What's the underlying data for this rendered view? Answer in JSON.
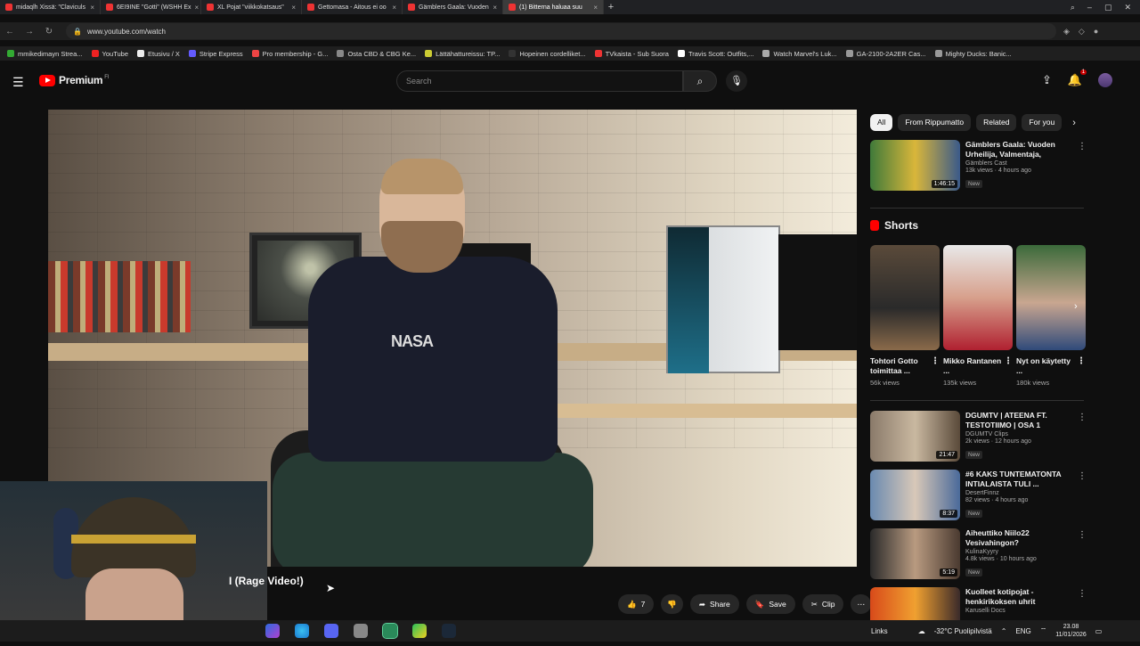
{
  "browser": {
    "tabs": [
      {
        "title": "midaqlh Xissä: \"Claviculs",
        "color": "#e33",
        "active": false
      },
      {
        "title": "6EI9INE \"Gotti\" (WSHH Ex",
        "color": "#e33",
        "active": false
      },
      {
        "title": "XL Pojat \"viikkokatsaus\"",
        "color": "#e33",
        "active": false
      },
      {
        "title": "Gettomasa - Aitous ei oo",
        "color": "#e33",
        "active": false
      },
      {
        "title": "Gämblers Gaala: Vuoden",
        "color": "#e33",
        "active": false
      },
      {
        "title": "(1) Bitterna haluaa suu",
        "color": "#e33",
        "active": true
      }
    ],
    "url": "www.youtube.com/watch",
    "bookmarks": [
      {
        "label": "mmikedimayn Strea...",
        "color": "#3a3"
      },
      {
        "label": "YouTube",
        "color": "#e22"
      },
      {
        "label": "Etusivu / X",
        "color": "#eee"
      },
      {
        "label": "Stripe Express",
        "color": "#635bff"
      },
      {
        "label": "Pro membership - G...",
        "color": "#e44"
      },
      {
        "label": "Osta CBD & CBG Ke...",
        "color": "#888"
      },
      {
        "label": "Lättähattureissu: TP...",
        "color": "#cc3"
      },
      {
        "label": "Hopeinen cordelliket...",
        "color": "#333"
      },
      {
        "label": "TVkaista - Sub Suora",
        "color": "#e33"
      },
      {
        "label": "Travis Scott: Outfits,...",
        "color": "#fff"
      },
      {
        "label": "Watch Marvel's Luk...",
        "color": "#aaa"
      },
      {
        "label": "GA-2100-2A2ER Cas...",
        "color": "#999"
      },
      {
        "label": "Mighty Ducks: Banic...",
        "color": "#999"
      }
    ]
  },
  "youtube": {
    "logo_text": "Premium",
    "logo_region": "FI",
    "search_placeholder": "Search",
    "notification_count": "1"
  },
  "video": {
    "title_visible": "I (Rage Video!)",
    "shirt_text": "NASA",
    "like_count": "7",
    "share_label": "Share",
    "save_label": "Save",
    "clip_label": "Clip"
  },
  "chips": [
    "All",
    "From Rippumatto",
    "Related",
    "For you"
  ],
  "top_video": {
    "title": "Gämblers Gaala: Vuoden Urheilija, Valmentaja, Joukkue...",
    "channel": "Gämblers Cast",
    "meta": "13k views · 4 hours ago",
    "badge": "New",
    "duration": "1:46:15",
    "thumb": "linear-gradient(90deg,#3f7a3a,#d9b63a 50%,#3a5a8a)"
  },
  "shorts_heading": "Shorts",
  "shorts": [
    {
      "title": "Tohtori Gotto toimittaa ...",
      "views": "56k views",
      "thumb": "linear-gradient(#5a4a3a,#2a2a2a 60%,#8a6a4a)"
    },
    {
      "title": "Mikko Rantanen ...",
      "views": "135k views",
      "thumb": "linear-gradient(#e8e8e8,#d7a08c 50%,#b02030)"
    },
    {
      "title": "Nyt on käytetty ...",
      "views": "180k views",
      "thumb": "linear-gradient(#3b6a3a,#c9a690 55%,#2f4a7a)"
    }
  ],
  "videos": [
    {
      "title": "DGUMTV | ATEENA FT. TESTOTIIMO | OSA 1",
      "channel": "DGUMTV Clips",
      "meta": "2k views · 12 hours ago",
      "badge": "New",
      "duration": "21:47",
      "thumb": "linear-gradient(90deg,#8a7a6a,#c9b8a0 50%,#5a4a3a)"
    },
    {
      "title": "#6 KAKS TUNTEMATONTA INTIALAISTA TULI ...",
      "channel": "DesertFinnz",
      "meta": "82 views · 4 hours ago",
      "badge": "New",
      "duration": "8:37",
      "thumb": "linear-gradient(90deg,#6a8ab0,#d8c8b8 50%,#4a6a9a)"
    },
    {
      "title": "Aiheuttiko Niilo22 Vesivahingon?",
      "channel": "KulinaKyyry",
      "meta": "4.8k views · 10 hours ago",
      "badge": "New",
      "duration": "5:19",
      "thumb": "linear-gradient(90deg,#2a2a2a,#b89a80 50%,#4a3a30)"
    },
    {
      "title": "Kuolleet kotipojat - henkirikoksen uhrit",
      "channel": "Karuselli Docs",
      "meta": "",
      "badge": "",
      "duration": "",
      "thumb": "linear-gradient(90deg,#d84a1a,#f0a030 50%,#3a2a2a)"
    }
  ],
  "taskbar": {
    "links_label": "Links",
    "weather": "-32°C  Puolipilvistä",
    "lang": "ENG",
    "time": "23.08",
    "date": "11/01/2026"
  }
}
